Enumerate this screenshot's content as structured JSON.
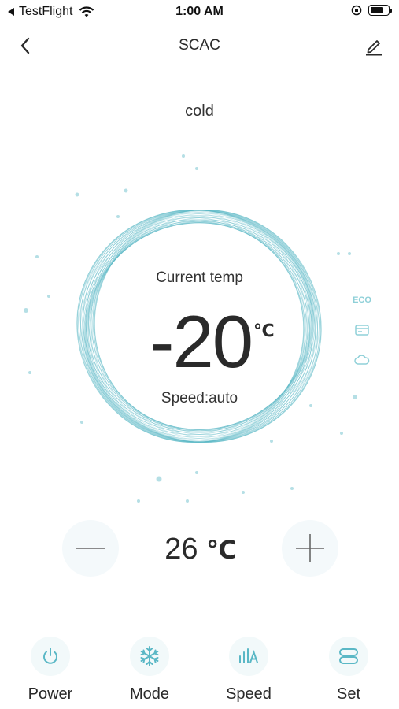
{
  "status_bar": {
    "back_app": "TestFlight",
    "time": "1:00 AM",
    "battery_level": 0.8
  },
  "nav": {
    "title": "SCAC",
    "back_icon": "chevron-left-icon",
    "edit_icon": "pencil-icon"
  },
  "mode_text": "cold",
  "dial": {
    "current_label": "Current temp",
    "current_value": "-20",
    "unit": "℃",
    "speed_label": "Speed:auto",
    "accent_color": "#5bb8c6"
  },
  "side_icons": [
    "ECO",
    "card-icon",
    "cloud-icon"
  ],
  "setpoint": {
    "value": "26",
    "unit": "℃",
    "minus_icon": "minus-icon",
    "plus_icon": "plus-icon"
  },
  "tabs": [
    {
      "label": "Power",
      "icon": "power-icon"
    },
    {
      "label": "Mode",
      "icon": "snowflake-icon"
    },
    {
      "label": "Speed",
      "icon": "fan-speed-icon"
    },
    {
      "label": "Set",
      "icon": "settings-toggle-icon"
    }
  ]
}
